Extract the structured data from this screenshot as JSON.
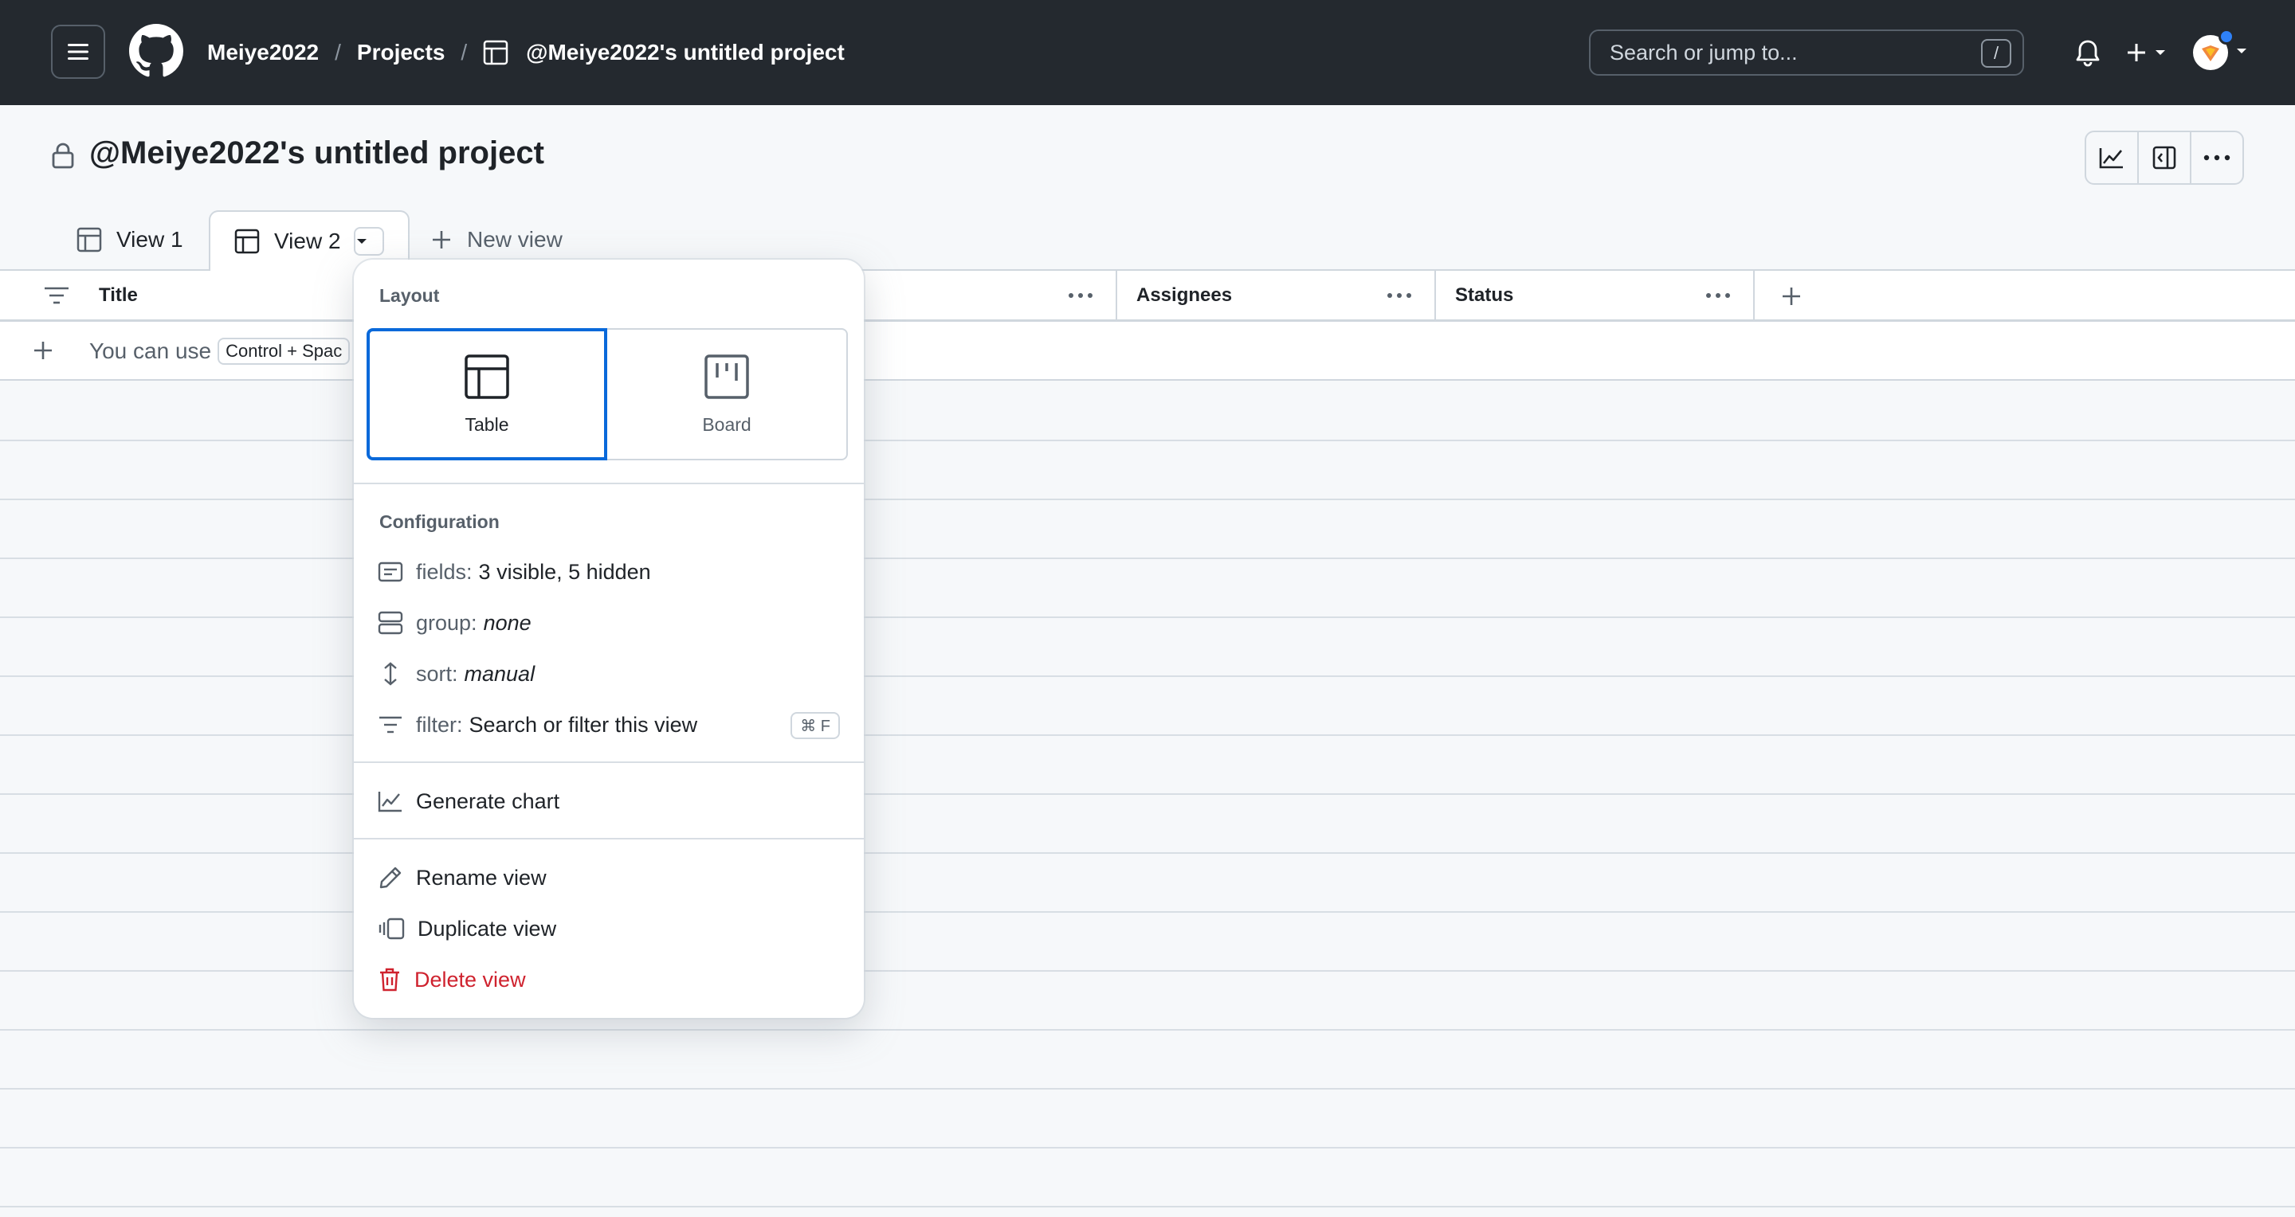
{
  "header": {
    "breadcrumb_user": "Meiye2022",
    "breadcrumb_sep1": "/",
    "breadcrumb_projects": "Projects",
    "breadcrumb_sep2": "/",
    "breadcrumb_project": "@Meiye2022's untitled project",
    "search_placeholder": "Search or jump to...",
    "search_shortcut": "/"
  },
  "project": {
    "title": "@Meiye2022's untitled project"
  },
  "tabs": [
    {
      "label": "View 1"
    },
    {
      "label": "View 2"
    },
    {
      "label": "New view"
    }
  ],
  "table": {
    "columns": [
      {
        "label": "Title"
      },
      {
        "label": "Assignees"
      },
      {
        "label": "Status"
      }
    ],
    "add_row_text": "You can use",
    "add_row_kbd": "Control + Spac"
  },
  "view_menu": {
    "layout_heading": "Layout",
    "layout_options": [
      {
        "label": "Table",
        "selected": true
      },
      {
        "label": "Board",
        "selected": false
      }
    ],
    "configuration_heading": "Configuration",
    "fields_key": "fields:",
    "fields_value": "3 visible, 5 hidden",
    "group_key": "group:",
    "group_value": "none",
    "sort_key": "sort:",
    "sort_value": "manual",
    "filter_key": "filter:",
    "filter_value": "Search or filter this view",
    "filter_shortcut": "⌘ F",
    "generate_chart": "Generate chart",
    "rename_view": "Rename view",
    "duplicate_view": "Duplicate view",
    "delete_view": "Delete view"
  },
  "colors": {
    "header_bg": "#24292f",
    "accent": "#0969da",
    "danger": "#cf222e",
    "notification_dot": "#2f81f7"
  }
}
